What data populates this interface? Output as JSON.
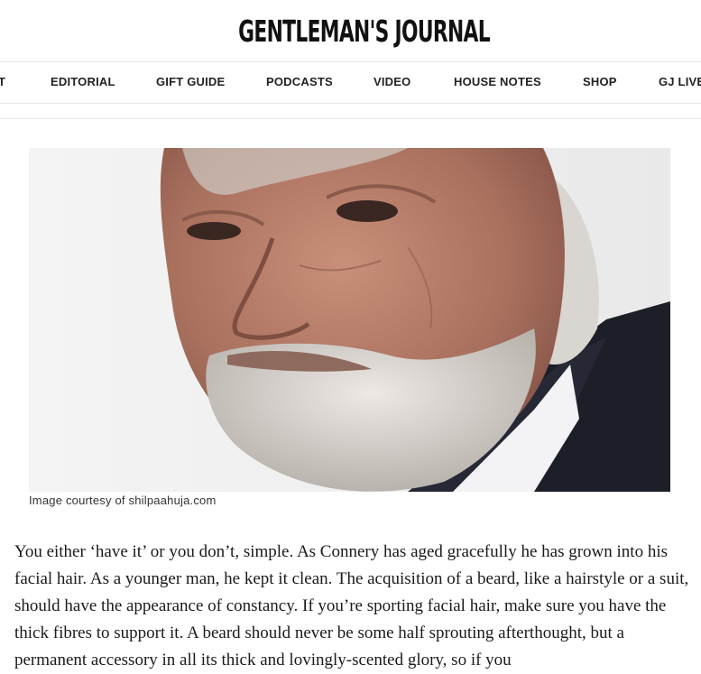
{
  "header": {
    "logo_text": "GENTLEMAN'S JOURNAL"
  },
  "nav": {
    "items": [
      {
        "label": "T"
      },
      {
        "label": "EDITORIAL"
      },
      {
        "label": "GIFT GUIDE"
      },
      {
        "label": "PODCASTS"
      },
      {
        "label": "VIDEO"
      },
      {
        "label": "HOUSE NOTES"
      },
      {
        "label": "SHOP"
      },
      {
        "label": "GJ LIVE"
      }
    ]
  },
  "article": {
    "image_caption": "Image courtesy of shilpaahuja.com",
    "paragraph": "You either ‘have it’ or you don’t, simple. As Connery has aged gracefully he has grown into his facial hair. As a younger man, he kept it clean. The acquisition of a beard, like a hairstyle or a suit, should have the appearance of constancy. If you’re sporting facial hair, make sure you have the thick fibres to support it. A beard should never be some half sprouting afterthought, but a permanent accessory in all its thick and lovingly-scented glory, so if you"
  },
  "colors": {
    "text": "#111111",
    "divider": "#e6e6e6",
    "background": "#ffffff"
  }
}
